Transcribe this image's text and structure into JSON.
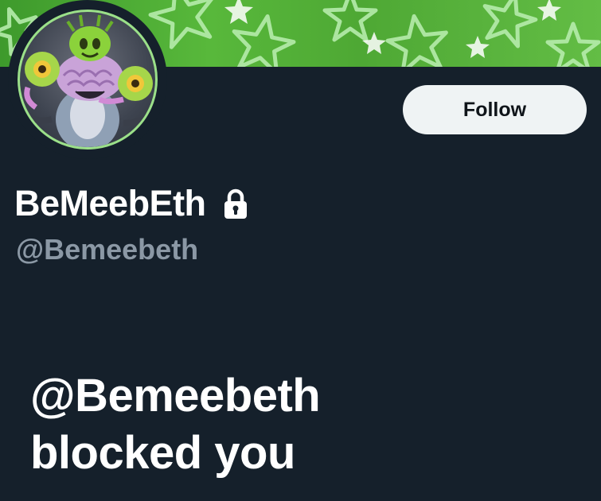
{
  "banner": {
    "primary_color": "#4ea834",
    "star_color": "#b6ecac",
    "icon": "star-pattern"
  },
  "profile": {
    "display_name": "BeMeebEth",
    "protected_icon": "lock-icon",
    "handle": "@Bemeebeth",
    "avatar_ring_color": "#9be089"
  },
  "actions": {
    "follow_label": "Follow"
  },
  "blocked_notice": {
    "handle_line": "@Bemeebeth",
    "message_line": "blocked you"
  },
  "colors": {
    "background": "#15202b",
    "text_primary": "#ffffff",
    "text_secondary": "#8b98a5",
    "button_bg": "#eff3f4"
  }
}
